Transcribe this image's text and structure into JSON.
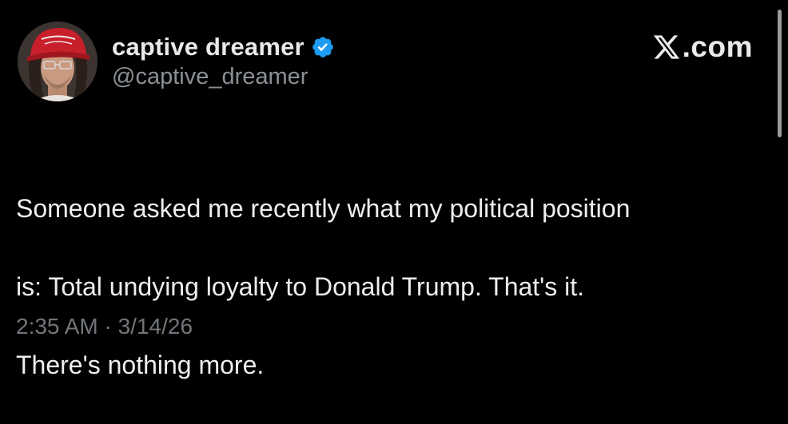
{
  "tweet": {
    "display_name": "captive dreamer",
    "handle": "@captive_dreamer",
    "verified": true,
    "site_label": ".com",
    "text_lines": [
      "Someone asked me recently what my political position",
      "is: Total undying loyalty to Donald Trump.  That's it.",
      "There's nothing more."
    ],
    "timestamp": "2:35 AM · 3/14/26"
  },
  "icons": {
    "verified": "verified-badge-icon",
    "site_logo": "x-logo-icon",
    "avatar": "profile-avatar"
  },
  "colors": {
    "background": "#000000",
    "text": "#e7e9ea",
    "secondary_text": "#8b9096",
    "verified_badge": "#1d9bf0",
    "hat": "#c8202b"
  }
}
